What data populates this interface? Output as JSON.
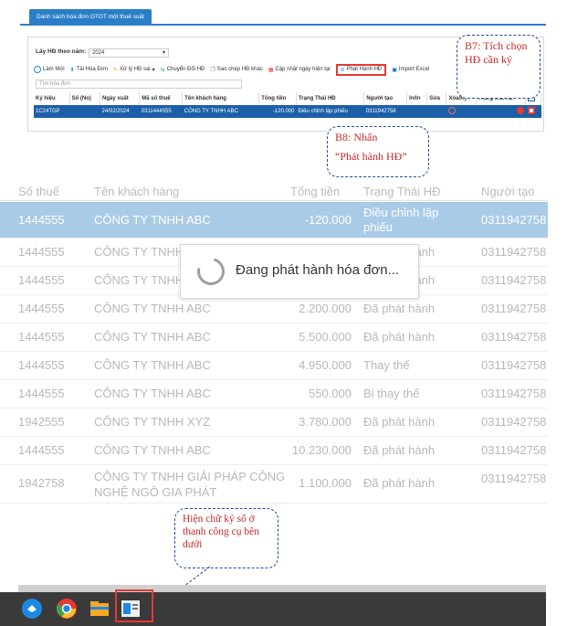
{
  "top": {
    "tab_title": "Danh sách hóa đơn GTGT một thuế suất",
    "filter_label": "Lấy HĐ theo năm:",
    "year_value": "2024",
    "search_placeholder": "Tìm hóa đơn",
    "toolbar": [
      {
        "label": "Làm Mới",
        "icon": "refresh-icon",
        "color": "#1e88e5"
      },
      {
        "label": "Tải Hóa Đơn",
        "icon": "download-icon",
        "color": "#1e88e5"
      },
      {
        "label": "Xử lý HĐ sai",
        "icon": "tools-icon",
        "color": "#fb8c00"
      },
      {
        "label": "Chuyển Đổi HĐ",
        "icon": "convert-icon",
        "color": "#43a047"
      },
      {
        "label": "Sao chép HĐ khác",
        "icon": "copy-icon",
        "color": "#43a047"
      },
      {
        "label": "Cập nhật ngày hiện tại",
        "icon": "calendar-icon",
        "color": "#e53935"
      },
      {
        "label": "Phát Hành HĐ",
        "icon": "publish-icon",
        "color": "#1e88e5"
      },
      {
        "label": "Import Excel",
        "icon": "excel-icon",
        "color": "#1565c0"
      }
    ],
    "columns": [
      "Ký hiệu",
      "Số (No)",
      "Ngày xuất",
      "Mã số thuế",
      "Tên khách hàng",
      "Tổng tiền",
      "Trạng Thái HĐ",
      "Người tạo",
      "In/In",
      "Sửa",
      "Xóa/Ký",
      "Trạng thái XL",
      ""
    ],
    "row": {
      "ky_hieu": "1C24TGP",
      "so": "",
      "ngay_xuat": "24/02/2024",
      "ma_so_thue": "0311444555",
      "ten_khach_hang": "CÔNG TY TNHH ABC",
      "tong_tien": "-120.000",
      "trang_thai": "Điều chỉnh lập phiếu",
      "nguoi_tao": "0311942758"
    }
  },
  "callouts": {
    "b7": "B7: Tích chọn HĐ cần ký",
    "b8_line1": "B8: Nhấn",
    "b8_line2": "“Phát hành HĐ”",
    "sign": "Hiện chữ ký số ở thanh công cụ bên dưới"
  },
  "big": {
    "header": [
      "Số thuế",
      "Tên khách hàng",
      "Tổng tiền",
      "Trạng Thái HĐ",
      "Người tạo"
    ],
    "rows": [
      {
        "mst": "1444555",
        "name": "CÔNG TY TNHH ABC",
        "amount": "-120.000",
        "status": "Điều chỉnh lập phiếu",
        "creator": "0311942758"
      },
      {
        "mst": "1444555",
        "name": "CÔNG TY TNHH ABC",
        "amount": "",
        "status": "Đã phát hành",
        "creator": "0311942758"
      },
      {
        "mst": "1444555",
        "name": "CÔNG TY TNHH ABC",
        "amount": "",
        "status": "Đã phát hành",
        "creator": "0311942758"
      },
      {
        "mst": "1444555",
        "name": "CÔNG TY TNHH ABC",
        "amount": "2.200.000",
        "status": "Đã phát hành",
        "creator": "0311942758"
      },
      {
        "mst": "1444555",
        "name": "CÔNG TY TNHH ABC",
        "amount": "5.500.000",
        "status": "Đã phát hành",
        "creator": "0311942758"
      },
      {
        "mst": "1444555",
        "name": "CÔNG TY TNHH ABC",
        "amount": "4.950.000",
        "status": "Thay thế",
        "creator": "0311942758"
      },
      {
        "mst": "1444555",
        "name": "CÔNG TY TNHH ABC",
        "amount": "550.000",
        "status": "Bị thay thế",
        "creator": "0311942758"
      },
      {
        "mst": "1942555",
        "name": "CÔNG TY TNHH XYZ",
        "amount": "3.780.000",
        "status": "Đã phát hành",
        "creator": "0311942758"
      },
      {
        "mst": "1444555",
        "name": "CÔNG TY TNHH ABC",
        "amount": "10.230.000",
        "status": "Đã phát hành",
        "creator": "0311942758"
      },
      {
        "mst": "1942758",
        "name": "CÔNG TY TNHH GIẢI PHÁP CÔNG NGHỆ NGÔ GIA PHÁT",
        "amount": "1.100.000",
        "status": "Đã phát hành",
        "creator": "0311942758"
      }
    ],
    "loading_text": "Đang phát hành hóa đơn..."
  },
  "taskbar": {
    "icons": [
      "windows-start-icon",
      "chrome-icon",
      "file-explorer-icon",
      "digital-signature-icon"
    ]
  }
}
